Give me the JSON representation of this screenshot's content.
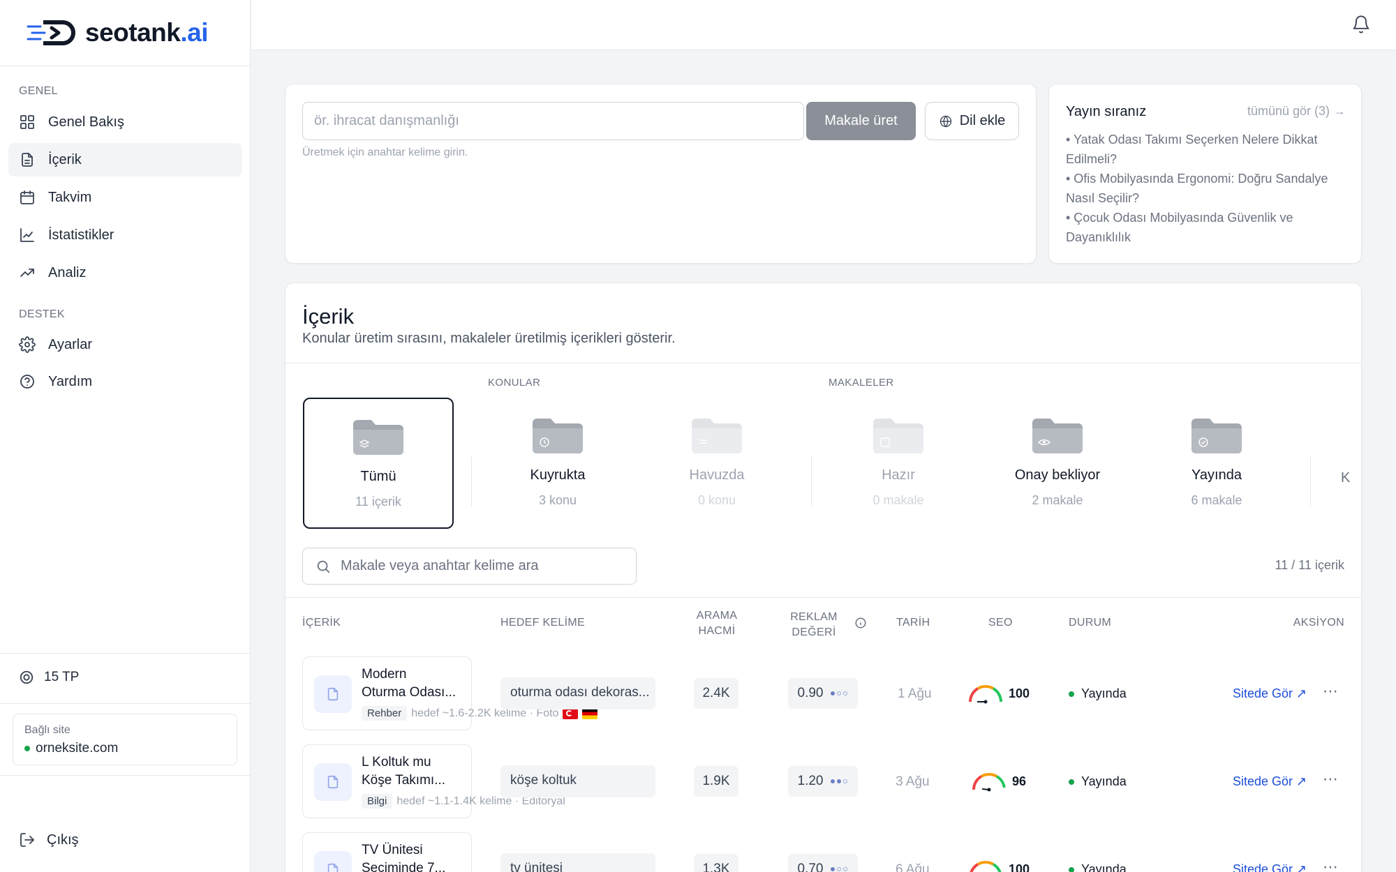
{
  "brand": {
    "name": "seotank",
    "suffix": ".ai"
  },
  "sidebar": {
    "section_general": "GENEL",
    "section_support": "DESTEK",
    "items": [
      {
        "label": "Genel Bakış",
        "icon": "grid-icon"
      },
      {
        "label": "İçerik",
        "icon": "document-icon",
        "active": true
      },
      {
        "label": "Takvim",
        "icon": "calendar-icon"
      },
      {
        "label": "İstatistikler",
        "icon": "line-chart-icon"
      },
      {
        "label": "Analiz",
        "icon": "trending-icon"
      },
      {
        "label": "Ayarlar",
        "icon": "gear-icon"
      },
      {
        "label": "Yardım",
        "icon": "help-icon"
      }
    ],
    "tp": "15 TP",
    "site_label": "Bağlı site",
    "site_value": "orneksite.com",
    "logout": "Çıkış"
  },
  "generator": {
    "placeholder": "ör. ihracat danışmanlığı",
    "generate_label": "Makale üret",
    "language_label": "Dil ekle",
    "hint": "Üretmek için anahtar kelime girin."
  },
  "queue": {
    "title": "Yayın sıranız",
    "view_all": "tümünü gör (3) →",
    "items": [
      "• Yatak Odası Takımı Seçerken Nelere Dikkat Edilmeli?",
      "• Ofis Mobilyasında Ergonomi: Doğru Sandalye Nasıl Seçilir?",
      "• Çocuk Odası Mobilyasında Güvenlik ve Dayanıklılık"
    ]
  },
  "content": {
    "title": "İçerik",
    "subtitle": "Konular üretim sırasını, makaleler üretilmiş içerikleri gösterir.",
    "group_topics": "KONULAR",
    "group_articles": "MAKALELER",
    "tiles": [
      {
        "label": "Tümü",
        "count": "11 içerik"
      },
      {
        "label": "Kuyrukta",
        "count": "3 konu"
      },
      {
        "label": "Havuzda",
        "count": "0 konu"
      },
      {
        "label": "Hazır",
        "count": "0 makale"
      },
      {
        "label": "Onay bekliyor",
        "count": "2 makale"
      },
      {
        "label": "Yayında",
        "count": "6 makale"
      }
    ],
    "overflow_tile_label": "K",
    "search_placeholder": "Makale veya anahtar kelime ara",
    "result_count": "11 / 11 içerik"
  },
  "table": {
    "headers": {
      "content": "İÇERİK",
      "keyword": "HEDEF KELİME",
      "volume_1": "ARAMA",
      "volume_2": "HACMİ",
      "ad_1": "REKLAM",
      "ad_2": "DEĞERİ",
      "date": "TARİH",
      "seo": "SEO",
      "status": "DURUM",
      "action": "AKSİYON"
    },
    "rows": [
      {
        "title_1": "Modern",
        "title_2": "Oturma Odası...",
        "tag": "Rehber",
        "meta": "hedef ~1.6-2.2K kelime · Foto",
        "keyword": "oturma odası dekoras...",
        "volume": "2.4K",
        "ad_value": "0.90",
        "date": "1 Ağu",
        "seo": "100",
        "status": "Yayında",
        "action": "Sitede Gör ↗"
      },
      {
        "title_1": "L Koltuk mu",
        "title_2": "Köşe Takımı...",
        "tag": "Bilgi",
        "meta": "hedef ~1.1-1.4K kelime · Editoryal",
        "keyword": "köşe koltuk",
        "volume": "1.9K",
        "ad_value": "1.20",
        "date": "3 Ağu",
        "seo": "96",
        "status": "Yayında",
        "action": "Sitede Gör ↗"
      },
      {
        "title_1": "TV Ünitesi",
        "title_2": "Seçiminde 7...",
        "tag": "",
        "meta": "",
        "keyword": "tv ünitesi",
        "volume": "1.3K",
        "ad_value": "0.70",
        "date": "6 Ağu",
        "seo": "100",
        "status": "Yayında",
        "action": "Sitede Gör ↗"
      }
    ]
  }
}
